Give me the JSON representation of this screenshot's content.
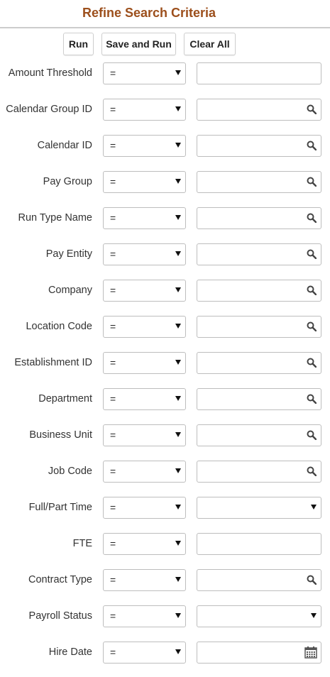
{
  "page": {
    "title": "Refine Search Criteria",
    "accent_color": "#9c4f1c"
  },
  "toolbar": {
    "run_label": "Run",
    "save_run_label": "Save and Run",
    "clear_all_label": "Clear All"
  },
  "criteria": [
    {
      "label": "Amount Threshold",
      "operator": "=",
      "value": "",
      "control": "text"
    },
    {
      "label": "Calendar Group ID",
      "operator": "=",
      "value": "",
      "control": "lookup"
    },
    {
      "label": "Calendar ID",
      "operator": "=",
      "value": "",
      "control": "lookup"
    },
    {
      "label": "Pay Group",
      "operator": "=",
      "value": "",
      "control": "lookup"
    },
    {
      "label": "Run Type Name",
      "operator": "=",
      "value": "",
      "control": "lookup"
    },
    {
      "label": "Pay Entity",
      "operator": "=",
      "value": "",
      "control": "lookup"
    },
    {
      "label": "Company",
      "operator": "=",
      "value": "",
      "control": "lookup"
    },
    {
      "label": "Location Code",
      "operator": "=",
      "value": "",
      "control": "lookup"
    },
    {
      "label": "Establishment ID",
      "operator": "=",
      "value": "",
      "control": "lookup"
    },
    {
      "label": "Department",
      "operator": "=",
      "value": "",
      "control": "lookup"
    },
    {
      "label": "Business Unit",
      "operator": "=",
      "value": "",
      "control": "lookup"
    },
    {
      "label": "Job Code",
      "operator": "=",
      "value": "",
      "control": "lookup"
    },
    {
      "label": "Full/Part Time",
      "operator": "=",
      "value": "",
      "control": "select"
    },
    {
      "label": "FTE",
      "operator": "=",
      "value": "",
      "control": "text"
    },
    {
      "label": "Contract Type",
      "operator": "=",
      "value": "",
      "control": "lookup"
    },
    {
      "label": "Payroll Status",
      "operator": "=",
      "value": "",
      "control": "select"
    },
    {
      "label": "Hire Date",
      "operator": "=",
      "value": "",
      "control": "date"
    }
  ],
  "icons": {
    "lookup": "search-icon",
    "select": "chevron-down-icon",
    "date": "calendar-icon"
  }
}
